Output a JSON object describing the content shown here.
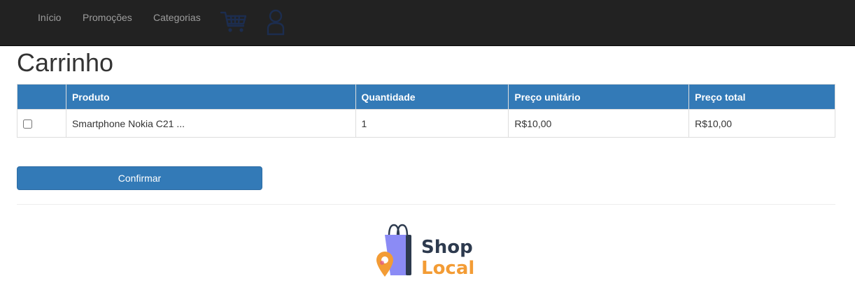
{
  "navbar": {
    "links": [
      {
        "label": "Início"
      },
      {
        "label": "Promoções"
      },
      {
        "label": "Categorias"
      }
    ],
    "icons": [
      "cart-icon",
      "user-icon"
    ],
    "background": "#222222",
    "link_color": "#9d9d9d",
    "icon_color": "#1c2d4f"
  },
  "page": {
    "title": "Carrinho"
  },
  "cart_table": {
    "headers": [
      "",
      "Produto",
      "Quantidade",
      "Preço unitário",
      "Preço total"
    ],
    "header_background": "#337ab7",
    "rows": [
      {
        "checked": false,
        "product": "Smartphone Nokia C21 ...",
        "quantity": "1",
        "unit_price": "R$10,00",
        "total_price": "R$10,00"
      }
    ]
  },
  "actions": {
    "confirm_label": "Confirmar",
    "confirm_color": "#337ab7"
  },
  "footer": {
    "logo_line1": "Shop",
    "logo_line2": "Local",
    "logo_colors": {
      "shop": "#2d3a4e",
      "local": "#f39c35",
      "bag": "#8b8bf5"
    }
  }
}
